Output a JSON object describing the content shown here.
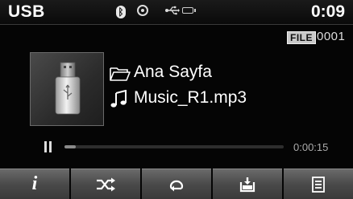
{
  "status": {
    "source": "USB",
    "time": "0:09",
    "icons": [
      "bluetooth-icon",
      "disc-icon",
      "usb-icon",
      "battery-icon"
    ]
  },
  "file": {
    "badge": "FILE",
    "number": "0001"
  },
  "now_playing": {
    "folder": "Ana Sayfa",
    "track": "Music_R1.mp3",
    "art_icon": "usb-drive-icon"
  },
  "progress": {
    "elapsed": "0:00:15",
    "fraction": 0.05,
    "state_icon": "pause-icon"
  },
  "controls": {
    "buttons": [
      {
        "icon": "info-icon",
        "glyph": "i"
      },
      {
        "icon": "shuffle-icon"
      },
      {
        "icon": "repeat-icon"
      },
      {
        "icon": "save-icon"
      },
      {
        "icon": "list-icon"
      }
    ]
  },
  "colors": {
    "background": "#050505",
    "text": "#ffffff",
    "button": "#5a5a5a"
  }
}
